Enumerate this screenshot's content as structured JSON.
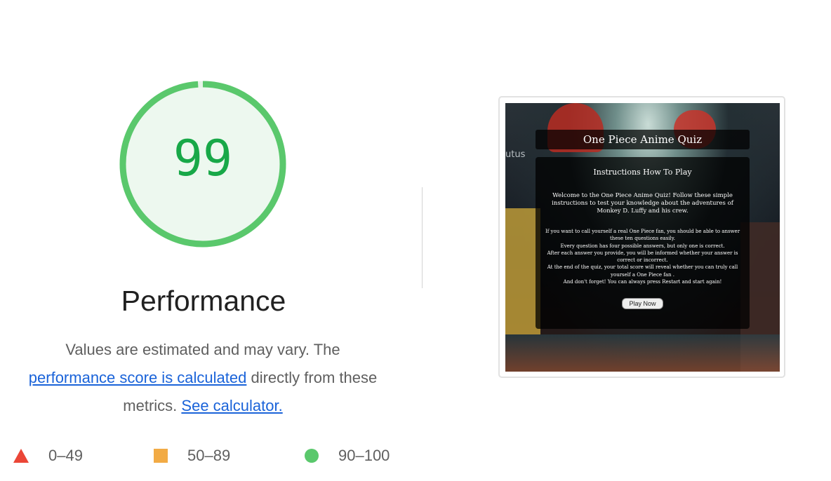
{
  "score": {
    "value": "99",
    "fraction": 0.99,
    "color": "#5ac86c"
  },
  "category": {
    "title": "Performance"
  },
  "description": {
    "text1": "Values are estimated and may vary. The",
    "link1": "performance score is calculated",
    "text2": " directly from these metrics. ",
    "link2": "See calculator."
  },
  "legend": [
    {
      "shape": "triangle",
      "label": "0–49",
      "color": "#eb4637"
    },
    {
      "shape": "square",
      "label": "50–89",
      "color": "#f2ab45"
    },
    {
      "shape": "circle",
      "label": "90–100",
      "color": "#5ac86c"
    }
  ],
  "screenshot": {
    "title": "One Piece Anime Quiz",
    "side_text": "utus",
    "panel_heading": "Instructions How To Play",
    "intro": "Welcome to the One Piece Anime Quiz! Follow these simple instructions to test your knowledge about the adventures of Monkey D. Luffy and his crew.",
    "lines": [
      "If you want to call yourself a real One Piece fan, you should be able to answer these ten questions easily.",
      "Every question has four possible answers, but only one is correct.",
      "After each answer you provide, you will be informed whether your answer is correct or incorrect.",
      "At the end of the quiz, your total score will reveal whether you can truly call yourself a One Piece fan .",
      "And don't forget! You can always press Restart and start again!"
    ],
    "button": "Play Now"
  }
}
